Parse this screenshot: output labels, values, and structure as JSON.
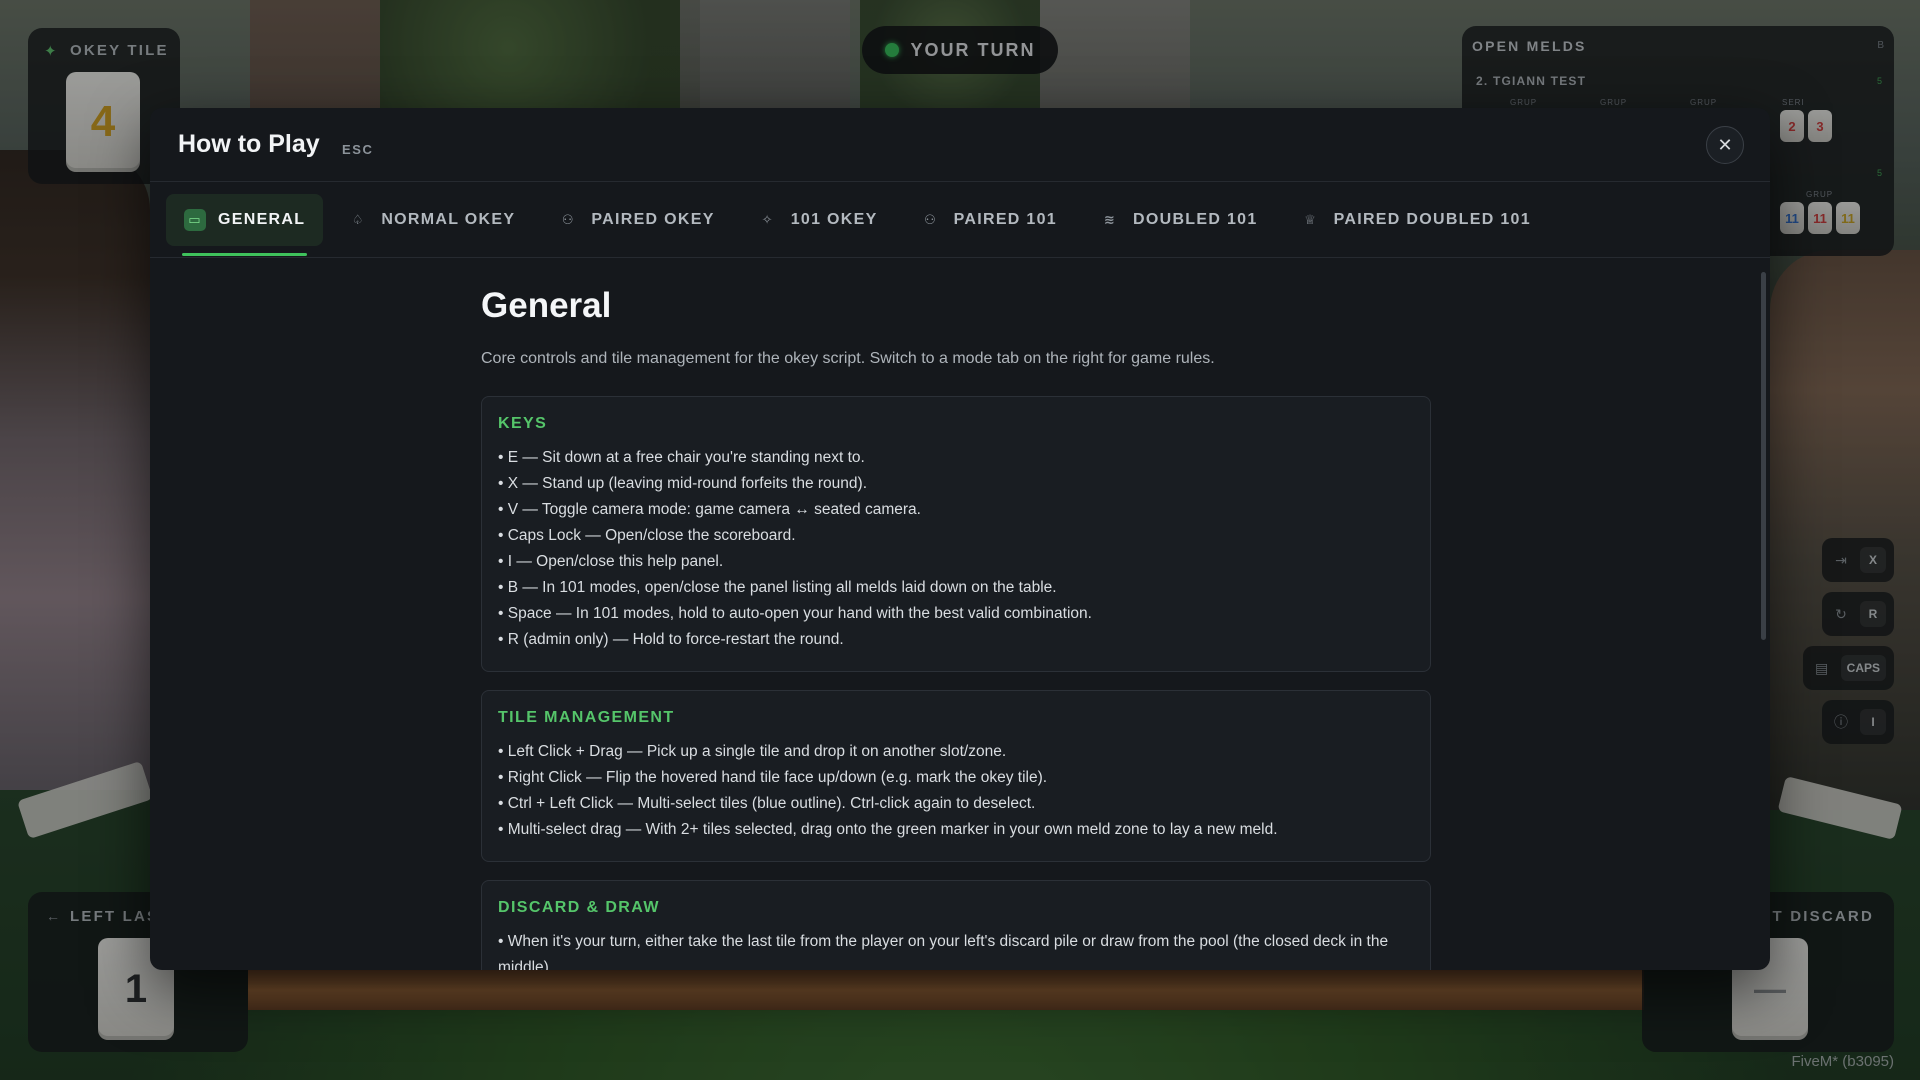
{
  "hud": {
    "okey_tile_label": "OKEY TILE",
    "okey_tile_value": "4",
    "turn_status": "YOUR TURN",
    "open_melds": {
      "title": "OPEN MELDS",
      "key_hint": "B",
      "player": "2. TGIANN TEST",
      "count_a": "5",
      "count_b": "5",
      "group_labels": [
        "GRUP",
        "GRUP",
        "GRUP",
        "SERI",
        "GRUP"
      ],
      "tiles_row1": [
        {
          "value": "2",
          "color": "#d23b3b"
        },
        {
          "value": "3",
          "color": "#d23b3b"
        }
      ],
      "tiles_row2": [
        {
          "value": "11",
          "color": "#2f6fd1"
        },
        {
          "value": "11",
          "color": "#d23b3b"
        },
        {
          "value": "11",
          "color": "#c9a21f"
        }
      ]
    },
    "left_discard_label": "LEFT LAS",
    "left_discard_value": "1",
    "right_discard_label": "ST DISCARD",
    "right_discard_value": "—",
    "keyhints": [
      {
        "icon": "exit-icon",
        "glyph": "⇥",
        "key": "X"
      },
      {
        "icon": "restart-icon",
        "glyph": "↻",
        "key": "R"
      },
      {
        "icon": "scoreboard-icon",
        "glyph": "▤",
        "key": "CAPS"
      },
      {
        "icon": "info-icon",
        "glyph": "ⓘ",
        "key": "I"
      }
    ],
    "build": "FiveM* (b3095)"
  },
  "modal": {
    "title": "How to Play",
    "esc_hint": "ESC",
    "close_glyph": "✕",
    "tabs": [
      {
        "label": "GENERAL",
        "icon": "keyboard-icon",
        "glyph": "▭",
        "active": true
      },
      {
        "label": "NORMAL OKEY",
        "icon": "spade-icon",
        "glyph": "♤",
        "active": false
      },
      {
        "label": "PAIRED OKEY",
        "icon": "users-icon",
        "glyph": "⚇",
        "active": false
      },
      {
        "label": "101 OKEY",
        "icon": "sparkle-icon",
        "glyph": "✧",
        "active": false
      },
      {
        "label": "PAIRED 101",
        "icon": "users-icon",
        "glyph": "⚇",
        "active": false
      },
      {
        "label": "DOUBLED 101",
        "icon": "layers-icon",
        "glyph": "≋",
        "active": false
      },
      {
        "label": "PAIRED DOUBLED 101",
        "icon": "trophy-icon",
        "glyph": "♕",
        "active": false
      }
    ],
    "section_title": "General",
    "section_sub": "Core controls and tile management for the okey script. Switch to a mode tab on the right for game rules.",
    "cards": [
      {
        "title": "KEYS",
        "lines": [
          "• E — Sit down at a free chair you're standing next to.",
          "• X — Stand up (leaving mid-round forfeits the round).",
          "• V — Toggle camera mode: game camera ↔ seated camera.",
          "• Caps Lock — Open/close the scoreboard.",
          "• I — Open/close this help panel.",
          "• B — In 101 modes, open/close the panel listing all melds laid down on the table.",
          "• Space — In 101 modes, hold to auto-open your hand with the best valid combination.",
          "• R (admin only) — Hold to force-restart the round."
        ]
      },
      {
        "title": "TILE MANAGEMENT",
        "lines": [
          "• Left Click + Drag — Pick up a single tile and drop it on another slot/zone.",
          "• Right Click — Flip the hovered hand tile face up/down (e.g. mark the okey tile).",
          "• Ctrl + Left Click — Multi-select tiles (blue outline). Ctrl-click again to deselect.",
          "• Multi-select drag — With 2+ tiles selected, drag onto the green marker in your own meld zone to lay a new meld."
        ]
      },
      {
        "title": "DISCARD & DRAW",
        "lines": [
          "• When it's your turn, either take the last tile from the player on your left's discard pile or draw from the pool (the closed deck in the middle)."
        ]
      }
    ]
  }
}
